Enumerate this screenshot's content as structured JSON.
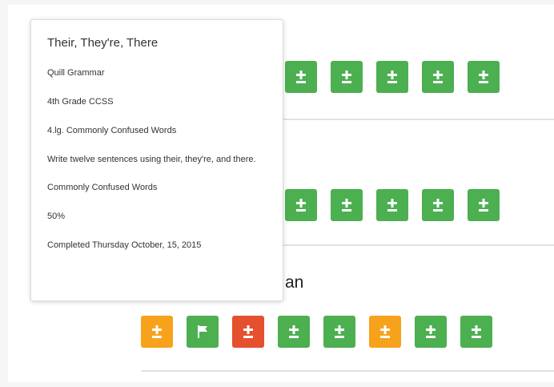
{
  "colors": {
    "green": "#4caf50",
    "orange": "#f7a21b",
    "red": "#e5502e"
  },
  "rows": [
    {
      "tiles": [
        {
          "status": "green",
          "icon": "plus-minus-icon"
        },
        {
          "status": "green",
          "icon": "plus-minus-icon"
        },
        {
          "status": "green",
          "icon": "plus-minus-icon"
        },
        {
          "status": "green",
          "icon": "plus-minus-icon"
        },
        {
          "status": "green",
          "icon": "plus-minus-icon"
        }
      ]
    },
    {
      "tiles": [
        {
          "status": "green",
          "icon": "plus-minus-icon"
        },
        {
          "status": "green",
          "icon": "plus-minus-icon"
        },
        {
          "status": "green",
          "icon": "plus-minus-icon"
        },
        {
          "status": "green",
          "icon": "plus-minus-icon"
        },
        {
          "status": "green",
          "icon": "plus-minus-icon"
        }
      ]
    },
    {
      "student_name": "an",
      "tiles": [
        {
          "status": "orange",
          "icon": "plus-minus-icon"
        },
        {
          "status": "green",
          "icon": "flag-icon"
        },
        {
          "status": "red",
          "icon": "plus-minus-icon"
        },
        {
          "status": "green",
          "icon": "plus-minus-icon"
        },
        {
          "status": "green",
          "icon": "plus-minus-icon"
        },
        {
          "status": "orange",
          "icon": "plus-minus-icon"
        },
        {
          "status": "green",
          "icon": "plus-minus-icon"
        },
        {
          "status": "green",
          "icon": "plus-minus-icon"
        }
      ]
    }
  ],
  "tooltip": {
    "title": "Their, They're, There",
    "app": "Quill Grammar",
    "standard_level": "4th Grade CCSS",
    "standard": "4.lg. Commonly Confused Words",
    "description": "Write twelve sentences using their, they're, and there.",
    "concept": "Commonly Confused Words",
    "score": "50%",
    "completed": "Completed Thursday October, 15, 2015"
  }
}
